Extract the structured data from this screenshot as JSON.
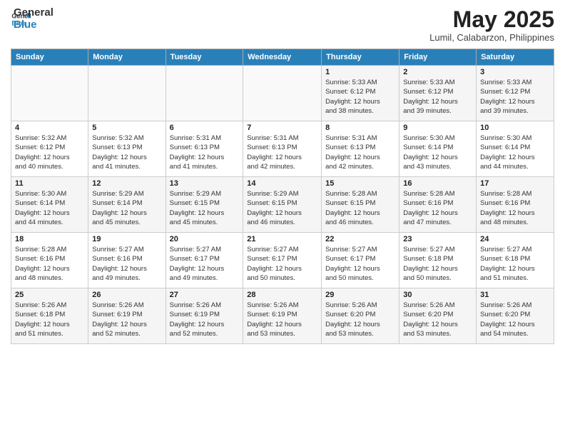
{
  "header": {
    "logo_general": "General",
    "logo_blue": "Blue",
    "month_title": "May 2025",
    "location": "Lumil, Calabarzon, Philippines"
  },
  "weekdays": [
    "Sunday",
    "Monday",
    "Tuesday",
    "Wednesday",
    "Thursday",
    "Friday",
    "Saturday"
  ],
  "weeks": [
    [
      {
        "day": "",
        "info": ""
      },
      {
        "day": "",
        "info": ""
      },
      {
        "day": "",
        "info": ""
      },
      {
        "day": "",
        "info": ""
      },
      {
        "day": "1",
        "info": "Sunrise: 5:33 AM\nSunset: 6:12 PM\nDaylight: 12 hours\nand 38 minutes."
      },
      {
        "day": "2",
        "info": "Sunrise: 5:33 AM\nSunset: 6:12 PM\nDaylight: 12 hours\nand 39 minutes."
      },
      {
        "day": "3",
        "info": "Sunrise: 5:33 AM\nSunset: 6:12 PM\nDaylight: 12 hours\nand 39 minutes."
      }
    ],
    [
      {
        "day": "4",
        "info": "Sunrise: 5:32 AM\nSunset: 6:12 PM\nDaylight: 12 hours\nand 40 minutes."
      },
      {
        "day": "5",
        "info": "Sunrise: 5:32 AM\nSunset: 6:13 PM\nDaylight: 12 hours\nand 41 minutes."
      },
      {
        "day": "6",
        "info": "Sunrise: 5:31 AM\nSunset: 6:13 PM\nDaylight: 12 hours\nand 41 minutes."
      },
      {
        "day": "7",
        "info": "Sunrise: 5:31 AM\nSunset: 6:13 PM\nDaylight: 12 hours\nand 42 minutes."
      },
      {
        "day": "8",
        "info": "Sunrise: 5:31 AM\nSunset: 6:13 PM\nDaylight: 12 hours\nand 42 minutes."
      },
      {
        "day": "9",
        "info": "Sunrise: 5:30 AM\nSunset: 6:14 PM\nDaylight: 12 hours\nand 43 minutes."
      },
      {
        "day": "10",
        "info": "Sunrise: 5:30 AM\nSunset: 6:14 PM\nDaylight: 12 hours\nand 44 minutes."
      }
    ],
    [
      {
        "day": "11",
        "info": "Sunrise: 5:30 AM\nSunset: 6:14 PM\nDaylight: 12 hours\nand 44 minutes."
      },
      {
        "day": "12",
        "info": "Sunrise: 5:29 AM\nSunset: 6:14 PM\nDaylight: 12 hours\nand 45 minutes."
      },
      {
        "day": "13",
        "info": "Sunrise: 5:29 AM\nSunset: 6:15 PM\nDaylight: 12 hours\nand 45 minutes."
      },
      {
        "day": "14",
        "info": "Sunrise: 5:29 AM\nSunset: 6:15 PM\nDaylight: 12 hours\nand 46 minutes."
      },
      {
        "day": "15",
        "info": "Sunrise: 5:28 AM\nSunset: 6:15 PM\nDaylight: 12 hours\nand 46 minutes."
      },
      {
        "day": "16",
        "info": "Sunrise: 5:28 AM\nSunset: 6:16 PM\nDaylight: 12 hours\nand 47 minutes."
      },
      {
        "day": "17",
        "info": "Sunrise: 5:28 AM\nSunset: 6:16 PM\nDaylight: 12 hours\nand 48 minutes."
      }
    ],
    [
      {
        "day": "18",
        "info": "Sunrise: 5:28 AM\nSunset: 6:16 PM\nDaylight: 12 hours\nand 48 minutes."
      },
      {
        "day": "19",
        "info": "Sunrise: 5:27 AM\nSunset: 6:16 PM\nDaylight: 12 hours\nand 49 minutes."
      },
      {
        "day": "20",
        "info": "Sunrise: 5:27 AM\nSunset: 6:17 PM\nDaylight: 12 hours\nand 49 minutes."
      },
      {
        "day": "21",
        "info": "Sunrise: 5:27 AM\nSunset: 6:17 PM\nDaylight: 12 hours\nand 50 minutes."
      },
      {
        "day": "22",
        "info": "Sunrise: 5:27 AM\nSunset: 6:17 PM\nDaylight: 12 hours\nand 50 minutes."
      },
      {
        "day": "23",
        "info": "Sunrise: 5:27 AM\nSunset: 6:18 PM\nDaylight: 12 hours\nand 50 minutes."
      },
      {
        "day": "24",
        "info": "Sunrise: 5:27 AM\nSunset: 6:18 PM\nDaylight: 12 hours\nand 51 minutes."
      }
    ],
    [
      {
        "day": "25",
        "info": "Sunrise: 5:26 AM\nSunset: 6:18 PM\nDaylight: 12 hours\nand 51 minutes."
      },
      {
        "day": "26",
        "info": "Sunrise: 5:26 AM\nSunset: 6:19 PM\nDaylight: 12 hours\nand 52 minutes."
      },
      {
        "day": "27",
        "info": "Sunrise: 5:26 AM\nSunset: 6:19 PM\nDaylight: 12 hours\nand 52 minutes."
      },
      {
        "day": "28",
        "info": "Sunrise: 5:26 AM\nSunset: 6:19 PM\nDaylight: 12 hours\nand 53 minutes."
      },
      {
        "day": "29",
        "info": "Sunrise: 5:26 AM\nSunset: 6:20 PM\nDaylight: 12 hours\nand 53 minutes."
      },
      {
        "day": "30",
        "info": "Sunrise: 5:26 AM\nSunset: 6:20 PM\nDaylight: 12 hours\nand 53 minutes."
      },
      {
        "day": "31",
        "info": "Sunrise: 5:26 AM\nSunset: 6:20 PM\nDaylight: 12 hours\nand 54 minutes."
      }
    ]
  ]
}
